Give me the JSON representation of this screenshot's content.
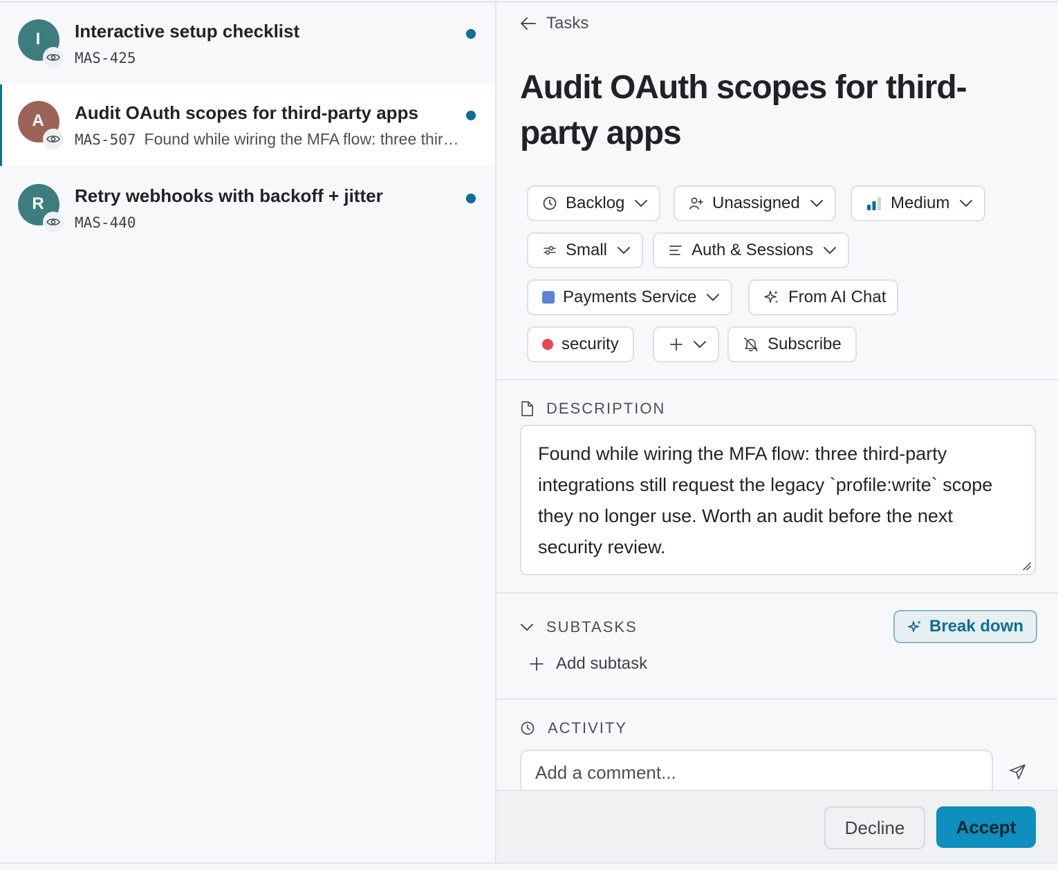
{
  "list": {
    "items": [
      {
        "avatar_letter": "I",
        "avatar_color": "#3e7d7f",
        "title": "Interactive setup checklist",
        "id": "MAS-425",
        "preview": "",
        "selected": false
      },
      {
        "avatar_letter": "A",
        "avatar_color": "#9b6356",
        "title": "Audit OAuth scopes for third-party apps",
        "id": "MAS-507",
        "preview": "Found while wiring the MFA flow: three third-party integrations still request the legacy `profile:write` scope they no longer use.",
        "selected": true
      },
      {
        "avatar_letter": "R",
        "avatar_color": "#3e7d7f",
        "title": "Retry webhooks with backoff + jitter",
        "id": "MAS-440",
        "preview": "",
        "selected": false
      }
    ]
  },
  "detail": {
    "back_label": "Tasks",
    "title": "Audit OAuth scopes for third-party apps",
    "chips": {
      "status": "Backlog",
      "assignee": "Unassigned",
      "priority": "Medium",
      "size": "Small",
      "area": "Auth & Sessions",
      "project": "Payments Service",
      "source": "From AI Chat",
      "label": "security",
      "subscribe": "Subscribe"
    },
    "colors": {
      "accent": "#0e8fbd",
      "project_square": "#5b84d6",
      "label_dot": "#e5484d",
      "priority_bars": "#0e6e94"
    },
    "description": {
      "heading": "DESCRIPTION",
      "text": "Found while wiring the MFA flow: three third-party integrations still request the legacy `profile:write` scope they no longer use. Worth an audit before the next security review."
    },
    "subtasks": {
      "heading": "SUBTASKS",
      "breakdown_label": "Break down",
      "add_label": "Add subtask"
    },
    "activity": {
      "heading": "ACTIVITY",
      "comment_placeholder": "Add a comment..."
    },
    "footer": {
      "decline_label": "Decline",
      "accept_label": "Accept"
    }
  }
}
